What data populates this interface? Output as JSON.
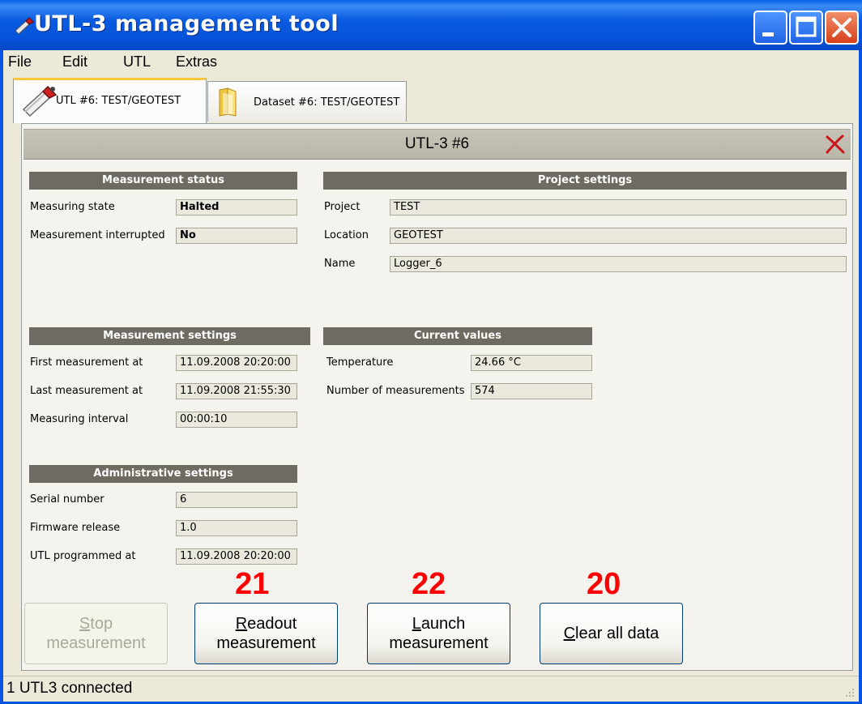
{
  "window": {
    "title": "UTL-3 management tool"
  },
  "menu": [
    "File",
    "Edit",
    "UTL",
    "Extras"
  ],
  "tabs": [
    {
      "label": "UTL #6: TEST/GEOTEST",
      "icon": "logger-icon"
    },
    {
      "label": "Dataset #6: TEST/GEOTEST",
      "icon": "folder-icon"
    }
  ],
  "page": {
    "title": "UTL-3 #6"
  },
  "measurement_status": {
    "header": "Measurement status",
    "rows": [
      {
        "label": "Measuring state",
        "value": "Halted"
      },
      {
        "label": "Measurement interrupted",
        "value": "No"
      }
    ]
  },
  "project_settings": {
    "header": "Project settings",
    "rows": [
      {
        "label": "Project",
        "value": "TEST"
      },
      {
        "label": "Location",
        "value": "GEOTEST"
      },
      {
        "label": "Name",
        "value": "Logger_6"
      }
    ]
  },
  "measurement_settings": {
    "header": "Measurement settings",
    "rows": [
      {
        "label": "First measurement at",
        "value": "11.09.2008 20:20:00"
      },
      {
        "label": "Last measurement at",
        "value": "11.09.2008 21:55:30"
      },
      {
        "label": "Measuring interval",
        "value": "00:00:10"
      }
    ]
  },
  "current_values": {
    "header": "Current values",
    "rows": [
      {
        "label": "Temperature",
        "value": "24.66 °C"
      },
      {
        "label": "Number of measurements",
        "value": "574"
      }
    ]
  },
  "administrative_settings": {
    "header": "Administrative settings",
    "rows": [
      {
        "label": "Serial number",
        "value": "6"
      },
      {
        "label": "Firmware release",
        "value": "1.0"
      },
      {
        "label": "UTL programmed at",
        "value": "11.09.2008 20:20:00"
      }
    ]
  },
  "annotations": [
    "21",
    "22",
    "20"
  ],
  "buttons": {
    "stop": {
      "mnemonic": "S",
      "line1_rest": "top",
      "line2": "measurement",
      "enabled": false
    },
    "readout": {
      "mnemonic": "R",
      "line1_rest": "eadout",
      "line2": "measurement"
    },
    "launch": {
      "mnemonic": "L",
      "line1_rest": "aunch",
      "line2": "measurement"
    },
    "clear": {
      "mnemonic": "C",
      "line1_rest": "lear all data"
    }
  },
  "status_bar": {
    "text": "1 UTL3 connected"
  },
  "colors": {
    "title_bar": "#0a54e3",
    "section_header": "#6f6b62",
    "annotation": "#ff0000",
    "background": "#ece9d8"
  }
}
